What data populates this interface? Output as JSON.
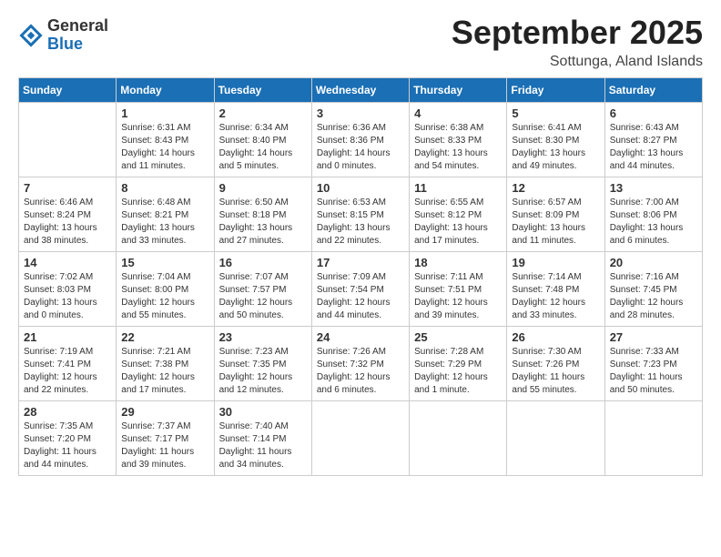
{
  "logo": {
    "general": "General",
    "blue": "Blue"
  },
  "header": {
    "month": "September 2025",
    "location": "Sottunga, Aland Islands"
  },
  "days_of_week": [
    "Sunday",
    "Monday",
    "Tuesday",
    "Wednesday",
    "Thursday",
    "Friday",
    "Saturday"
  ],
  "weeks": [
    [
      {
        "day": "",
        "empty": true
      },
      {
        "day": "1",
        "sunrise": "Sunrise: 6:31 AM",
        "sunset": "Sunset: 8:43 PM",
        "daylight": "Daylight: 14 hours and 11 minutes."
      },
      {
        "day": "2",
        "sunrise": "Sunrise: 6:34 AM",
        "sunset": "Sunset: 8:40 PM",
        "daylight": "Daylight: 14 hours and 5 minutes."
      },
      {
        "day": "3",
        "sunrise": "Sunrise: 6:36 AM",
        "sunset": "Sunset: 8:36 PM",
        "daylight": "Daylight: 14 hours and 0 minutes."
      },
      {
        "day": "4",
        "sunrise": "Sunrise: 6:38 AM",
        "sunset": "Sunset: 8:33 PM",
        "daylight": "Daylight: 13 hours and 54 minutes."
      },
      {
        "day": "5",
        "sunrise": "Sunrise: 6:41 AM",
        "sunset": "Sunset: 8:30 PM",
        "daylight": "Daylight: 13 hours and 49 minutes."
      },
      {
        "day": "6",
        "sunrise": "Sunrise: 6:43 AM",
        "sunset": "Sunset: 8:27 PM",
        "daylight": "Daylight: 13 hours and 44 minutes."
      }
    ],
    [
      {
        "day": "7",
        "sunrise": "Sunrise: 6:46 AM",
        "sunset": "Sunset: 8:24 PM",
        "daylight": "Daylight: 13 hours and 38 minutes."
      },
      {
        "day": "8",
        "sunrise": "Sunrise: 6:48 AM",
        "sunset": "Sunset: 8:21 PM",
        "daylight": "Daylight: 13 hours and 33 minutes."
      },
      {
        "day": "9",
        "sunrise": "Sunrise: 6:50 AM",
        "sunset": "Sunset: 8:18 PM",
        "daylight": "Daylight: 13 hours and 27 minutes."
      },
      {
        "day": "10",
        "sunrise": "Sunrise: 6:53 AM",
        "sunset": "Sunset: 8:15 PM",
        "daylight": "Daylight: 13 hours and 22 minutes."
      },
      {
        "day": "11",
        "sunrise": "Sunrise: 6:55 AM",
        "sunset": "Sunset: 8:12 PM",
        "daylight": "Daylight: 13 hours and 17 minutes."
      },
      {
        "day": "12",
        "sunrise": "Sunrise: 6:57 AM",
        "sunset": "Sunset: 8:09 PM",
        "daylight": "Daylight: 13 hours and 11 minutes."
      },
      {
        "day": "13",
        "sunrise": "Sunrise: 7:00 AM",
        "sunset": "Sunset: 8:06 PM",
        "daylight": "Daylight: 13 hours and 6 minutes."
      }
    ],
    [
      {
        "day": "14",
        "sunrise": "Sunrise: 7:02 AM",
        "sunset": "Sunset: 8:03 PM",
        "daylight": "Daylight: 13 hours and 0 minutes."
      },
      {
        "day": "15",
        "sunrise": "Sunrise: 7:04 AM",
        "sunset": "Sunset: 8:00 PM",
        "daylight": "Daylight: 12 hours and 55 minutes."
      },
      {
        "day": "16",
        "sunrise": "Sunrise: 7:07 AM",
        "sunset": "Sunset: 7:57 PM",
        "daylight": "Daylight: 12 hours and 50 minutes."
      },
      {
        "day": "17",
        "sunrise": "Sunrise: 7:09 AM",
        "sunset": "Sunset: 7:54 PM",
        "daylight": "Daylight: 12 hours and 44 minutes."
      },
      {
        "day": "18",
        "sunrise": "Sunrise: 7:11 AM",
        "sunset": "Sunset: 7:51 PM",
        "daylight": "Daylight: 12 hours and 39 minutes."
      },
      {
        "day": "19",
        "sunrise": "Sunrise: 7:14 AM",
        "sunset": "Sunset: 7:48 PM",
        "daylight": "Daylight: 12 hours and 33 minutes."
      },
      {
        "day": "20",
        "sunrise": "Sunrise: 7:16 AM",
        "sunset": "Sunset: 7:45 PM",
        "daylight": "Daylight: 12 hours and 28 minutes."
      }
    ],
    [
      {
        "day": "21",
        "sunrise": "Sunrise: 7:19 AM",
        "sunset": "Sunset: 7:41 PM",
        "daylight": "Daylight: 12 hours and 22 minutes."
      },
      {
        "day": "22",
        "sunrise": "Sunrise: 7:21 AM",
        "sunset": "Sunset: 7:38 PM",
        "daylight": "Daylight: 12 hours and 17 minutes."
      },
      {
        "day": "23",
        "sunrise": "Sunrise: 7:23 AM",
        "sunset": "Sunset: 7:35 PM",
        "daylight": "Daylight: 12 hours and 12 minutes."
      },
      {
        "day": "24",
        "sunrise": "Sunrise: 7:26 AM",
        "sunset": "Sunset: 7:32 PM",
        "daylight": "Daylight: 12 hours and 6 minutes."
      },
      {
        "day": "25",
        "sunrise": "Sunrise: 7:28 AM",
        "sunset": "Sunset: 7:29 PM",
        "daylight": "Daylight: 12 hours and 1 minute."
      },
      {
        "day": "26",
        "sunrise": "Sunrise: 7:30 AM",
        "sunset": "Sunset: 7:26 PM",
        "daylight": "Daylight: 11 hours and 55 minutes."
      },
      {
        "day": "27",
        "sunrise": "Sunrise: 7:33 AM",
        "sunset": "Sunset: 7:23 PM",
        "daylight": "Daylight: 11 hours and 50 minutes."
      }
    ],
    [
      {
        "day": "28",
        "sunrise": "Sunrise: 7:35 AM",
        "sunset": "Sunset: 7:20 PM",
        "daylight": "Daylight: 11 hours and 44 minutes."
      },
      {
        "day": "29",
        "sunrise": "Sunrise: 7:37 AM",
        "sunset": "Sunset: 7:17 PM",
        "daylight": "Daylight: 11 hours and 39 minutes."
      },
      {
        "day": "30",
        "sunrise": "Sunrise: 7:40 AM",
        "sunset": "Sunset: 7:14 PM",
        "daylight": "Daylight: 11 hours and 34 minutes."
      },
      {
        "day": "",
        "empty": true
      },
      {
        "day": "",
        "empty": true
      },
      {
        "day": "",
        "empty": true
      },
      {
        "day": "",
        "empty": true
      }
    ]
  ]
}
